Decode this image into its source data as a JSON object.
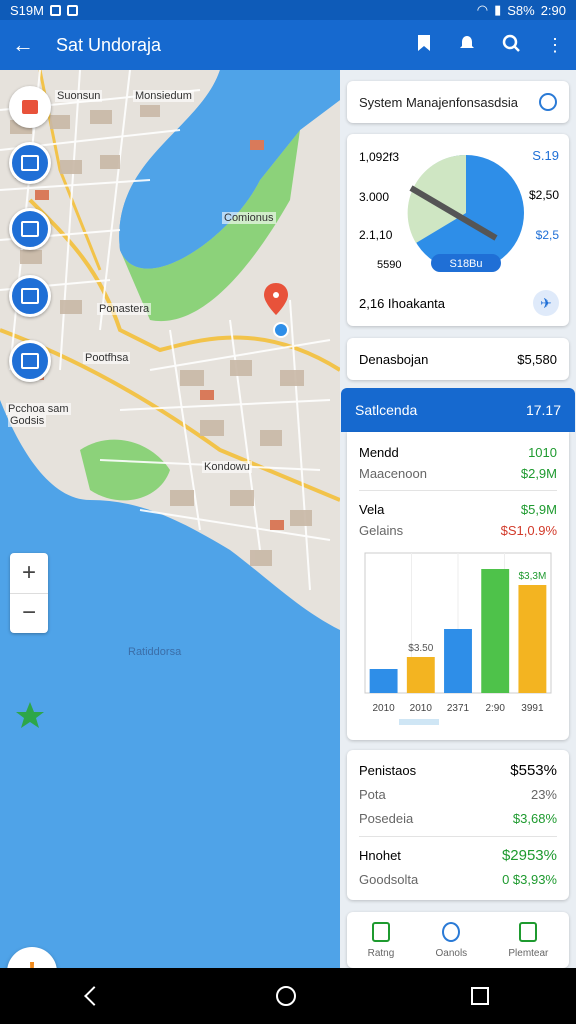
{
  "status_bar": {
    "time_left": "S19M",
    "battery": "S8%",
    "time_right": "2:90"
  },
  "app_bar": {
    "title": "Sat Undoraja"
  },
  "map": {
    "labels": [
      "Suonsun",
      "Monsiedum",
      "Comionus",
      "Ponastera",
      "Pootfhsa",
      "Pcchoa sam",
      "Godsis",
      "Kondowu",
      "Ratiddorsa"
    ],
    "zoom_in": "+",
    "zoom_out": "−"
  },
  "system_card": {
    "title": "System Manajenfonsasdsia"
  },
  "gauge_card": {
    "values": [
      "1,092f3",
      "3.000",
      "2.1,10",
      "5590"
    ],
    "right_values": [
      "S.19",
      "$2,50",
      "$2,5"
    ],
    "center_label": "S18Bu",
    "footer": "2,16 Ihoakanta"
  },
  "summary_row": {
    "label": "Denasbojan",
    "value": "$5,580"
  },
  "stats_header": {
    "label": "Satlcenda",
    "value": "17.17"
  },
  "stats_card": {
    "rows": [
      {
        "label": "Mendd",
        "value": "1010"
      },
      {
        "label": "Maacenoon",
        "value": "$2,9M"
      },
      {
        "label": "Vela",
        "value": "$5,9M"
      },
      {
        "label": "Gelains",
        "value": "$S1,0.9%"
      }
    ],
    "chart_top_label": "$3,3M"
  },
  "chart_data": {
    "type": "bar",
    "categories": [
      "2010",
      "2010",
      "2371",
      "2:90",
      "3991"
    ],
    "values": [
      12,
      18,
      32,
      62,
      54
    ],
    "bar_labels": [
      "",
      "$3.50",
      "",
      "",
      "$3,3M"
    ],
    "colors": [
      "#2e8ee8",
      "#f3b421",
      "#2e8ee8",
      "#4ec24a",
      "#f3b421"
    ],
    "ylim": [
      0,
      70
    ]
  },
  "finance_card": {
    "rows": [
      {
        "label": "Penistaos",
        "value": "$553%"
      },
      {
        "label": "Pota",
        "value": "23%"
      },
      {
        "label": "Posedeia",
        "value": "$3,68%"
      },
      {
        "label": "Hnohet",
        "value": "$2953%"
      },
      {
        "label": "Goodsolta",
        "value": "0 $3,93%"
      }
    ]
  },
  "tabs": [
    "Ratng",
    "Oanols",
    "Plemtear"
  ]
}
